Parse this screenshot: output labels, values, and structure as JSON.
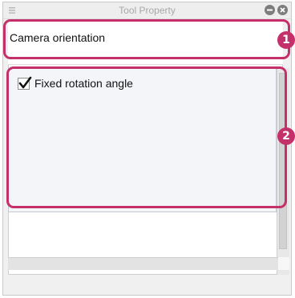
{
  "window": {
    "title": "Tool Property"
  },
  "header": {
    "label": "Camera orientation"
  },
  "settings": {
    "fixed_rotation": {
      "label": "Fixed rotation angle",
      "checked": true
    }
  },
  "callouts": [
    "1",
    "2"
  ],
  "colors": {
    "highlight": "#c4306a",
    "panel_background": "#f0f0f0",
    "settings_background": "#f4f5f8"
  },
  "icons": {
    "grip": "grip-icon",
    "minimize": "minimize-icon",
    "close": "close-icon",
    "check": "checkmark-icon"
  }
}
